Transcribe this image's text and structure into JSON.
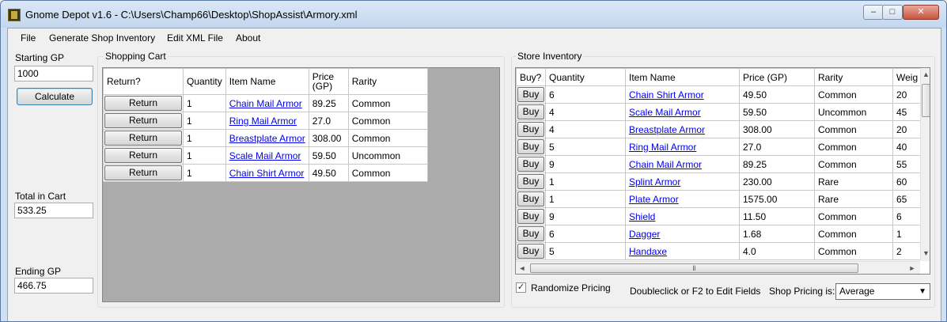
{
  "window": {
    "title": "Gnome Depot v1.6 - C:\\Users\\Champ66\\Desktop\\ShopAssist\\Armory.xml",
    "minimize": "–",
    "maximize": "□",
    "close": "✕"
  },
  "menu": [
    "File",
    "Generate Shop Inventory",
    "Edit XML File",
    "About"
  ],
  "left": {
    "starting_gp_label": "Starting GP",
    "starting_gp_value": "1000",
    "calculate_label": "Calculate",
    "total_label": "Total in Cart",
    "total_value": "533.25",
    "ending_label": "Ending GP",
    "ending_value": "466.75"
  },
  "cart": {
    "title": "Shopping Cart",
    "headers": [
      "Return?",
      "Quantity",
      "Item Name",
      "Price (GP)",
      "Rarity"
    ],
    "rows": [
      {
        "button": "Return",
        "qty": "1",
        "name": "Chain Mail Armor",
        "price": "89.25",
        "rarity": "Common"
      },
      {
        "button": "Return",
        "qty": "1",
        "name": "Ring Mail Armor",
        "price": "27.0",
        "rarity": "Common"
      },
      {
        "button": "Return",
        "qty": "1",
        "name": "Breastplate Armor",
        "price": "308.00",
        "rarity": "Common"
      },
      {
        "button": "Return",
        "qty": "1",
        "name": "Scale Mail Armor",
        "price": "59.50",
        "rarity": "Uncommon"
      },
      {
        "button": "Return",
        "qty": "1",
        "name": "Chain Shirt Armor",
        "price": "49.50",
        "rarity": "Common"
      }
    ]
  },
  "store": {
    "title": "Store Inventory",
    "headers": [
      "Buy?",
      "Quantity",
      "Item Name",
      "Price (GP)",
      "Rarity",
      "Weig"
    ],
    "rows": [
      {
        "button": "Buy",
        "qty": "6",
        "name": "Chain Shirt Armor",
        "price": "49.50",
        "rarity": "Common",
        "weight": "20"
      },
      {
        "button": "Buy",
        "qty": "4",
        "name": "Scale Mail Armor",
        "price": "59.50",
        "rarity": "Uncommon",
        "weight": "45"
      },
      {
        "button": "Buy",
        "qty": "4",
        "name": "Breastplate Armor",
        "price": "308.00",
        "rarity": "Common",
        "weight": "20"
      },
      {
        "button": "Buy",
        "qty": "5",
        "name": "Ring Mail Armor",
        "price": "27.0",
        "rarity": "Common",
        "weight": "40"
      },
      {
        "button": "Buy",
        "qty": "9",
        "name": "Chain Mail Armor",
        "price": "89.25",
        "rarity": "Common",
        "weight": "55"
      },
      {
        "button": "Buy",
        "qty": "1",
        "name": "Splint Armor",
        "price": "230.00",
        "rarity": "Rare",
        "weight": "60"
      },
      {
        "button": "Buy",
        "qty": "1",
        "name": "Plate Armor",
        "price": "1575.00",
        "rarity": "Rare",
        "weight": "65"
      },
      {
        "button": "Buy",
        "qty": "9",
        "name": "Shield",
        "price": "11.50",
        "rarity": "Common",
        "weight": "6"
      },
      {
        "button": "Buy",
        "qty": "6",
        "name": "Dagger",
        "price": "1.68",
        "rarity": "Common",
        "weight": "1"
      },
      {
        "button": "Buy",
        "qty": "5",
        "name": "Handaxe",
        "price": "4.0",
        "rarity": "Common",
        "weight": "2"
      }
    ],
    "scroll": {
      "up": "▲",
      "down": "▼",
      "left": "◄",
      "right": "►",
      "grip": "Ⅱ"
    }
  },
  "footer": {
    "randomize_label": "Randomize Pricing",
    "randomize_checked": "✓",
    "hint": "Doubleclick or F2 to Edit Fields",
    "pricing_label": "Shop Pricing is:",
    "pricing_value": "Average",
    "pricing_arrow": "▼"
  }
}
